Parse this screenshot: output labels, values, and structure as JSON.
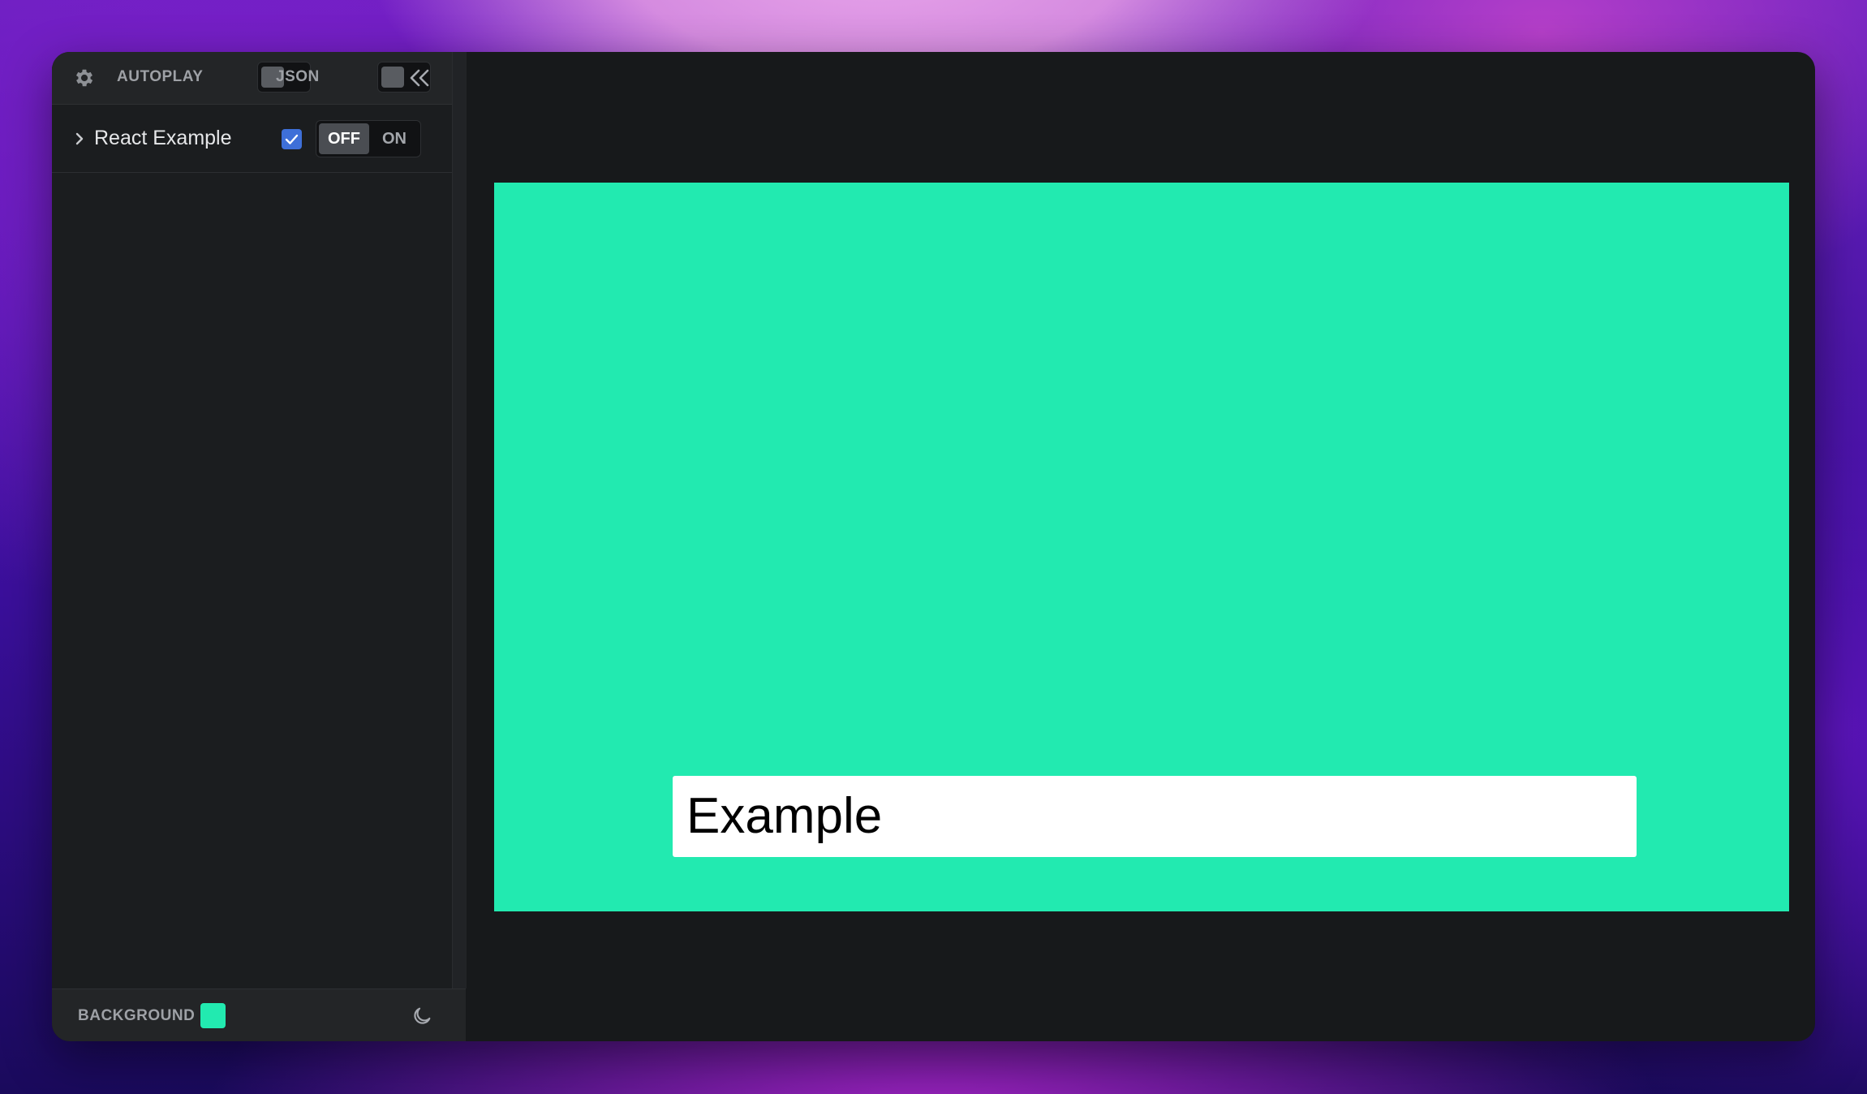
{
  "header": {
    "autoplay_label": "AUTOPLAY",
    "autoplay_on": false,
    "json_label": "JSON",
    "json_on": false
  },
  "panel": {
    "items": [
      {
        "label": "React Example",
        "enabled": true,
        "options": [
          "OFF",
          "ON"
        ],
        "selected": "OFF"
      }
    ]
  },
  "footer": {
    "background_label": "BACKGROUND",
    "background_color": "#22eab0"
  },
  "preview": {
    "stage_color": "#22eab0",
    "text": "Example"
  },
  "colors": {
    "window_bg": "#17191b",
    "panel_bg": "#1b1d1f",
    "accent_checkbox": "#3e6fd8"
  }
}
